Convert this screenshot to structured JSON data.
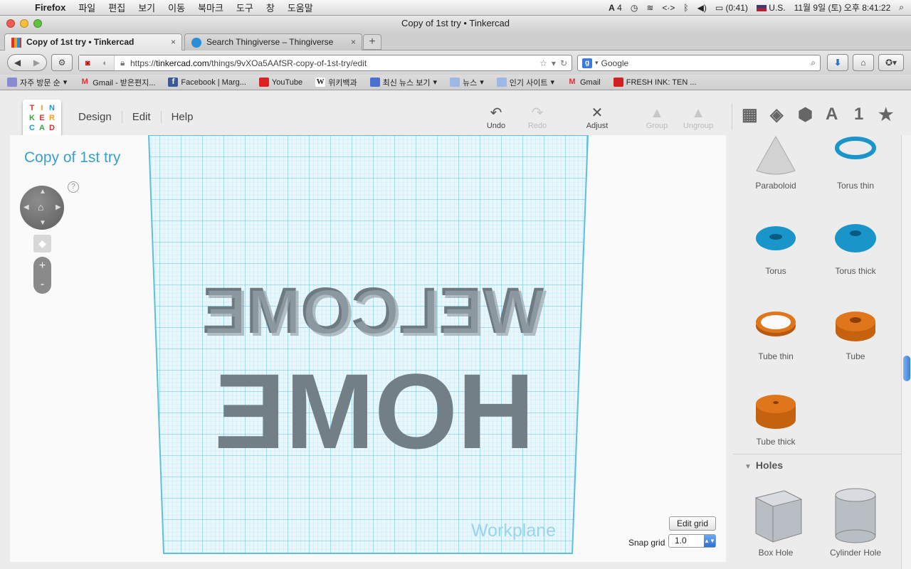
{
  "os_menubar": {
    "items": [
      "Firefox",
      "파일",
      "편집",
      "보기",
      "이동",
      "북마크",
      "도구",
      "창",
      "도움말"
    ],
    "status": {
      "adobe_count": "4",
      "battery": "(0:41)",
      "input_lang": "U.S.",
      "datetime": "11월 9일 (토) 오후  8:41:22"
    }
  },
  "window": {
    "title": "Copy of 1st try • Tinkercad"
  },
  "tabs": [
    {
      "label": "Copy of 1st try • Tinkercad",
      "active": true
    },
    {
      "label": "Search Thingiverse – Thingiverse",
      "active": false
    }
  ],
  "nav": {
    "url_prefix": "https://",
    "url_host": "tinkercad.com",
    "url_path": "/things/9vXOa5AAfSR-copy-of-1st-try/edit",
    "search_placeholder": "Google"
  },
  "bookmarks": [
    "자주 방문 순",
    "Gmail - 받은편지...",
    "Facebook | Marg...",
    "YouTube",
    "위키백과",
    "최신 뉴스 보기",
    "뉴스",
    "인기 사이트",
    "Gmail",
    "FRESH INK: TEN ..."
  ],
  "app": {
    "logo_letters": [
      "T",
      "I",
      "N",
      "K",
      "E",
      "R",
      "C",
      "A",
      "D"
    ],
    "logo_colors": [
      "#e0302a",
      "#f59a1d",
      "#1c96d6",
      "#3aa043",
      "#e0302a",
      "#f59a1d",
      "#1c96d6",
      "#3aa043",
      "#e0302a"
    ],
    "menu": [
      "Design",
      "Edit",
      "Help"
    ],
    "tools": {
      "undo": "Undo",
      "redo": "Redo",
      "adjust": "Adjust",
      "group": "Group",
      "ungroup": "Ungroup"
    },
    "view_icons": [
      "grid-icon",
      "box-icon",
      "pattern-box-icon",
      "text-icon",
      "number-icon",
      "star-icon"
    ],
    "view_labels": {
      "text": "A",
      "number": "1",
      "star": "★"
    }
  },
  "canvas": {
    "doc_title": "Copy of 1st try",
    "help": "?",
    "workplane_label": "Workplane",
    "model_text_line1": "WELCOME",
    "model_text_line2": "HOME",
    "edit_grid": "Edit grid",
    "snap_grid_label": "Snap grid",
    "snap_grid_value": "1.0"
  },
  "panel": {
    "shapes": [
      {
        "label": "Paraboloid",
        "color": "#cfcfcf"
      },
      {
        "label": "Torus thin",
        "color": "#1a95c9"
      },
      {
        "label": "Torus",
        "color": "#1a95c9"
      },
      {
        "label": "Torus thick",
        "color": "#1a95c9"
      },
      {
        "label": "Tube thin",
        "color": "#e0761b"
      },
      {
        "label": "Tube",
        "color": "#e0761b"
      },
      {
        "label": "Tube thick",
        "color": "#e0761b"
      }
    ],
    "holes_header": "Holes",
    "holes": [
      {
        "label": "Box Hole"
      },
      {
        "label": "Cylinder Hole"
      }
    ]
  }
}
